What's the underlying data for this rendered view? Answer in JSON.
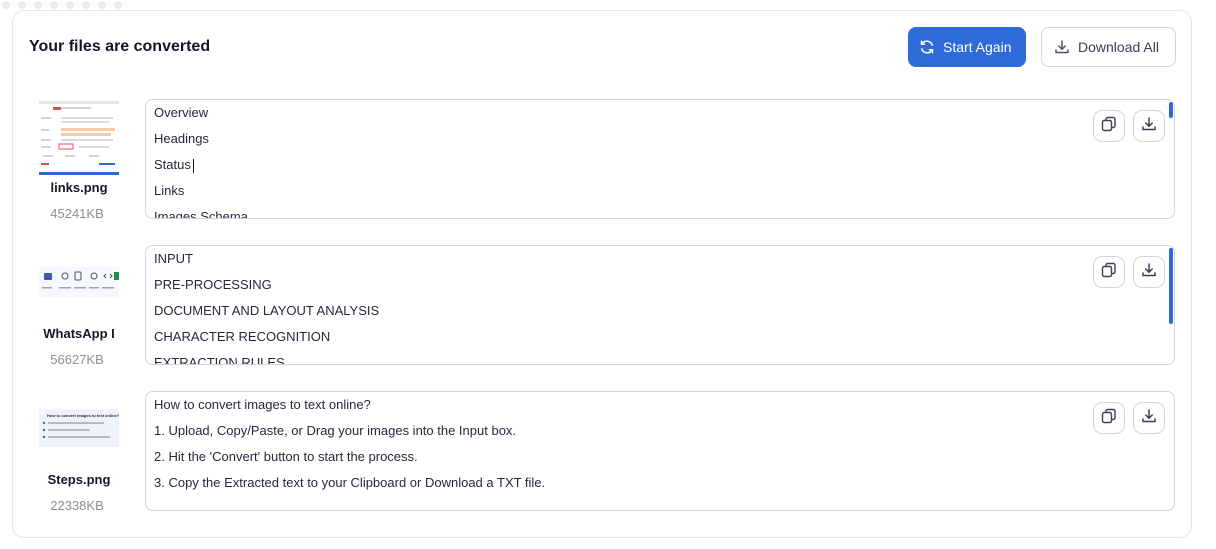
{
  "header": {
    "title": "Your files are converted",
    "start_again_label": "Start Again",
    "download_all_label": "Download All"
  },
  "colors": {
    "accent": "#2f6bd8",
    "border": "#d1d5db",
    "muted": "#8a8f98"
  },
  "icons": {
    "start_again": "refresh-icon",
    "download_all": "download-icon",
    "copy": "copy-icon",
    "download": "download-icon"
  },
  "files": [
    {
      "name": "links.png",
      "size": "45241KB",
      "lines": [
        "Overview",
        "Headings",
        "Status",
        "Links",
        "Images Schema"
      ]
    },
    {
      "name": "WhatsApp I",
      "size": "56627KB",
      "lines": [
        "INPUT",
        "PRE-PROCESSING",
        "DOCUMENT AND LAYOUT ANALYSIS",
        "CHARACTER RECOGNITION",
        "EXTRACTION RULES"
      ]
    },
    {
      "name": "Steps.png",
      "size": "22338KB",
      "lines": [
        "How to convert images to text online?",
        "1. Upload, Copy/Paste, or Drag your images into the Input box.",
        "2. Hit the 'Convert' button to start the process.",
        "3. Copy the Extracted text to your Clipboard or Download a TXT file."
      ],
      "thumb_text": "How to convert images to text online?"
    }
  ]
}
